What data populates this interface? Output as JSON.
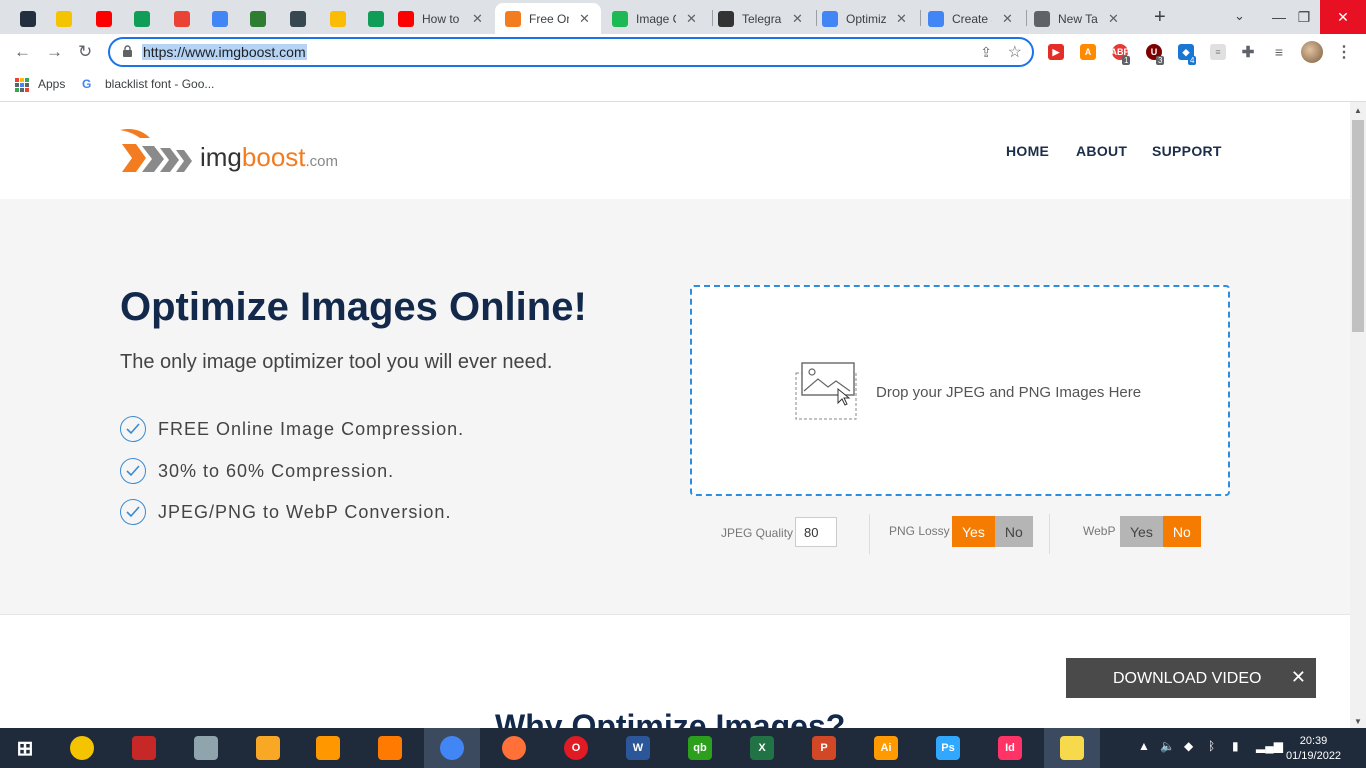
{
  "browser": {
    "tabs": [
      {
        "title": "",
        "favicon": "amazon-icon",
        "color": "#232f3e"
      },
      {
        "title": "",
        "favicon": "norton-icon",
        "color": "#f5c400"
      },
      {
        "title": "",
        "favicon": "youtube-icon",
        "color": "#ff0000"
      },
      {
        "title": "",
        "favicon": "sheets-icon",
        "color": "#0f9d58"
      },
      {
        "title": "",
        "favicon": "gmail-icon",
        "color": "#ea4335"
      },
      {
        "title": "",
        "favicon": "globe-icon",
        "color": "#4285f4"
      },
      {
        "title": "",
        "favicon": "pen-icon",
        "color": "#2e7d32"
      },
      {
        "title": "",
        "favicon": "feather-icon",
        "color": "#37474f"
      },
      {
        "title": "",
        "favicon": "accessibility-icon",
        "color": "#fbbc05"
      },
      {
        "title": "",
        "favicon": "sheets-icon",
        "color": "#0f9d58"
      },
      {
        "title": "How to",
        "favicon": "youtube-icon",
        "color": "#ff0000"
      },
      {
        "title": "Free On",
        "favicon": "imgboost-icon",
        "color": "#f47c20"
      },
      {
        "title": "Image C",
        "favicon": "image-compressor-icon",
        "color": "#1db954"
      },
      {
        "title": "Telegra",
        "favicon": "telegraph-icon",
        "color": "#333333"
      },
      {
        "title": "Optimiz",
        "favicon": "docs-icon",
        "color": "#4285f4"
      },
      {
        "title": "Create a",
        "favicon": "docs-icon",
        "color": "#4285f4"
      },
      {
        "title": "New Tab",
        "favicon": "chrome-icon",
        "color": "#5f6368"
      }
    ],
    "url": "https://www.imgboost.com",
    "bookmarks": {
      "apps": "Apps",
      "item1": "blacklist font - Goo..."
    },
    "extensions": {
      "abp_badge": "1",
      "u_badge": "3",
      "ext4_badge": "4"
    }
  },
  "site": {
    "logo": {
      "img": "img",
      "boost": "boost",
      "com": ".com"
    },
    "nav": {
      "home": "HOME",
      "about": "ABOUT",
      "support": "SUPPORT"
    },
    "hero": {
      "title": "Optimize Images Online!",
      "subtitle": "The only image optimizer tool you will ever need.",
      "features": [
        "FREE Online Image Compression.",
        "30% to 60% Compression.",
        "JPEG/PNG to WebP Conversion."
      ]
    },
    "dropzone": {
      "text": "Drop your JPEG and PNG Images Here"
    },
    "options": {
      "jpeg_quality_label": "JPEG Quality",
      "jpeg_quality_value": "80",
      "png_lossy_label": "PNG Lossy",
      "webp_label": "WebP",
      "yes": "Yes",
      "no": "No",
      "png_lossy_selected": "Yes",
      "webp_selected": "No"
    },
    "why_heading": "Why Optimize Images?",
    "download_video": {
      "label": "DOWNLOAD VIDEO",
      "close": "✕"
    }
  },
  "taskbar": {
    "apps": [
      {
        "name": "windows-start-icon",
        "color": "#ffffff"
      },
      {
        "name": "norton-taskbar-icon",
        "color": "#f5c400"
      },
      {
        "name": "xilisoft-icon",
        "color": "#c62828"
      },
      {
        "name": "media-icon",
        "color": "#90a4ae"
      },
      {
        "name": "file-explorer-icon",
        "color": "#f9a825"
      },
      {
        "name": "video-player-icon",
        "color": "#ff9800"
      },
      {
        "name": "vlc-icon",
        "color": "#ff7a00"
      },
      {
        "name": "chrome-taskbar-icon",
        "color": "#4285f4"
      },
      {
        "name": "firefox-icon",
        "color": "#ff7139"
      },
      {
        "name": "opera-icon",
        "color": "#e01b24"
      },
      {
        "name": "word-icon",
        "color": "#2b579a"
      },
      {
        "name": "quickbooks-icon",
        "color": "#2ca01c"
      },
      {
        "name": "excel-icon",
        "color": "#217346"
      },
      {
        "name": "powerpoint-icon",
        "color": "#d24726"
      },
      {
        "name": "illustrator-icon",
        "color": "#ff9a00"
      },
      {
        "name": "photoshop-icon",
        "color": "#31a8ff"
      },
      {
        "name": "indesign-icon",
        "color": "#ff3366"
      },
      {
        "name": "sticky-notes-icon",
        "color": "#f7d94c"
      }
    ],
    "time": "20:39",
    "date": "01/19/2022"
  },
  "colors": {
    "brand_orange": "#f47c20",
    "navy": "#13294b",
    "accent_blue": "#2d8ee0"
  }
}
